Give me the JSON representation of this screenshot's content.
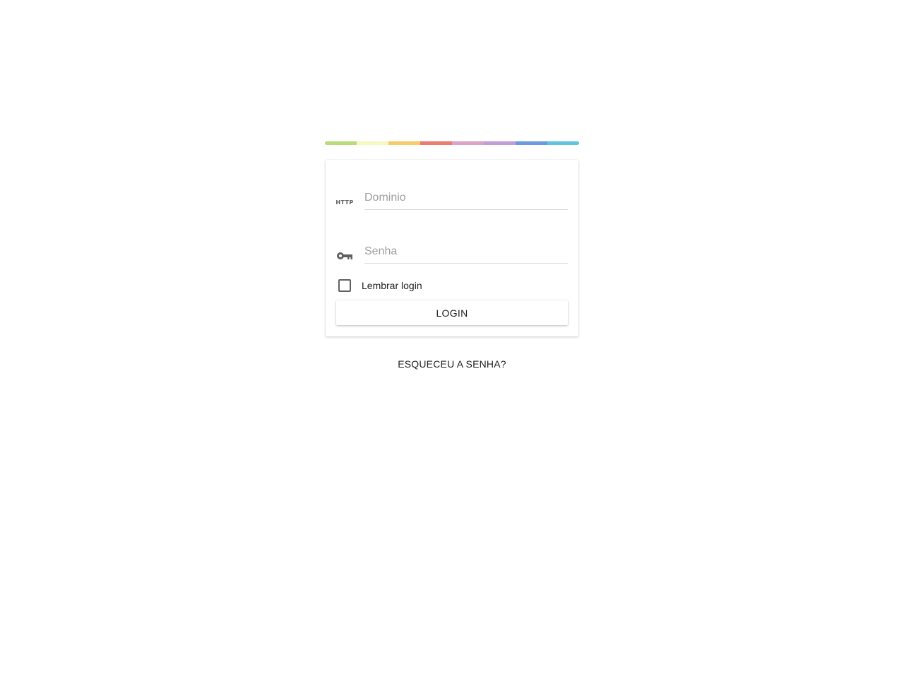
{
  "stripe": {
    "colors": [
      "#b9dc7a",
      "#f5f8c0",
      "#f7ca6a",
      "#ea7d6d",
      "#dba3c6",
      "#c29ed8",
      "#6c9adf",
      "#62c3de"
    ]
  },
  "form": {
    "domain": {
      "icon": "http-icon",
      "icon_text": "HTTP",
      "placeholder": "Dominio",
      "value": ""
    },
    "password": {
      "icon": "key-icon",
      "placeholder": "Senha",
      "value": ""
    },
    "remember": {
      "label": "Lembrar login",
      "checked": false
    },
    "login_label": "LOGIN"
  },
  "forgot_password_label": "ESQUECEU A SENHA?"
}
